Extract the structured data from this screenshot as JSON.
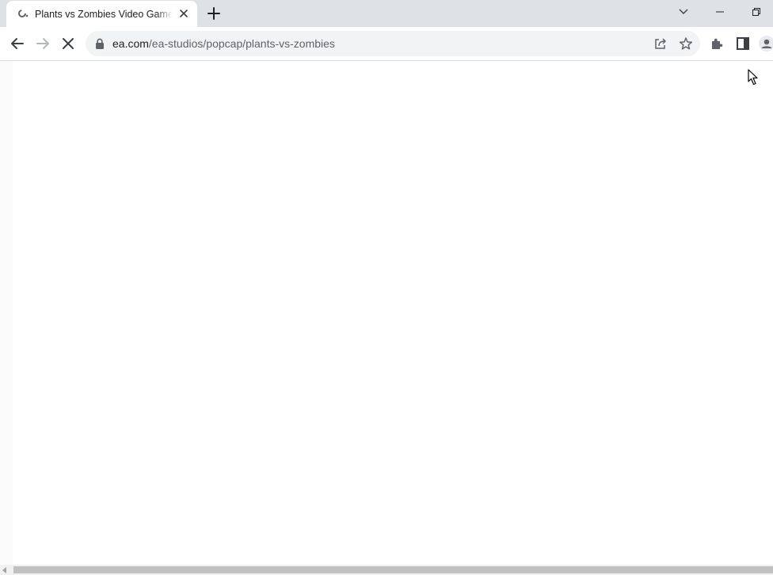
{
  "browser": {
    "tab": {
      "title": "Plants vs Zombies Video Games",
      "favicon": "loading-spinner-icon",
      "close_icon": "close-icon"
    },
    "new_tab_icon": "plus-icon",
    "window_controls": [
      "chevron-down-icon",
      "minimize-icon",
      "restore-icon"
    ],
    "toolbar": {
      "back_icon": "arrow-left-icon",
      "forward_icon": "arrow-right-icon",
      "stop_icon": "close-icon",
      "url_domain": "ea.com",
      "url_path": "/ea-studios/popcap/plants-vs-zombies",
      "omnibox_icons": [
        "share-icon",
        "star-icon"
      ],
      "extension_icons": [
        "puzzle-icon",
        "side-panel-icon",
        "profile-icon"
      ]
    },
    "page_state": "loading (blank)",
    "colors": {
      "tabstrip": "#dee1e6",
      "omnibox": "#f1f3f4",
      "icon": "#5f6368",
      "text": "#202124"
    }
  }
}
